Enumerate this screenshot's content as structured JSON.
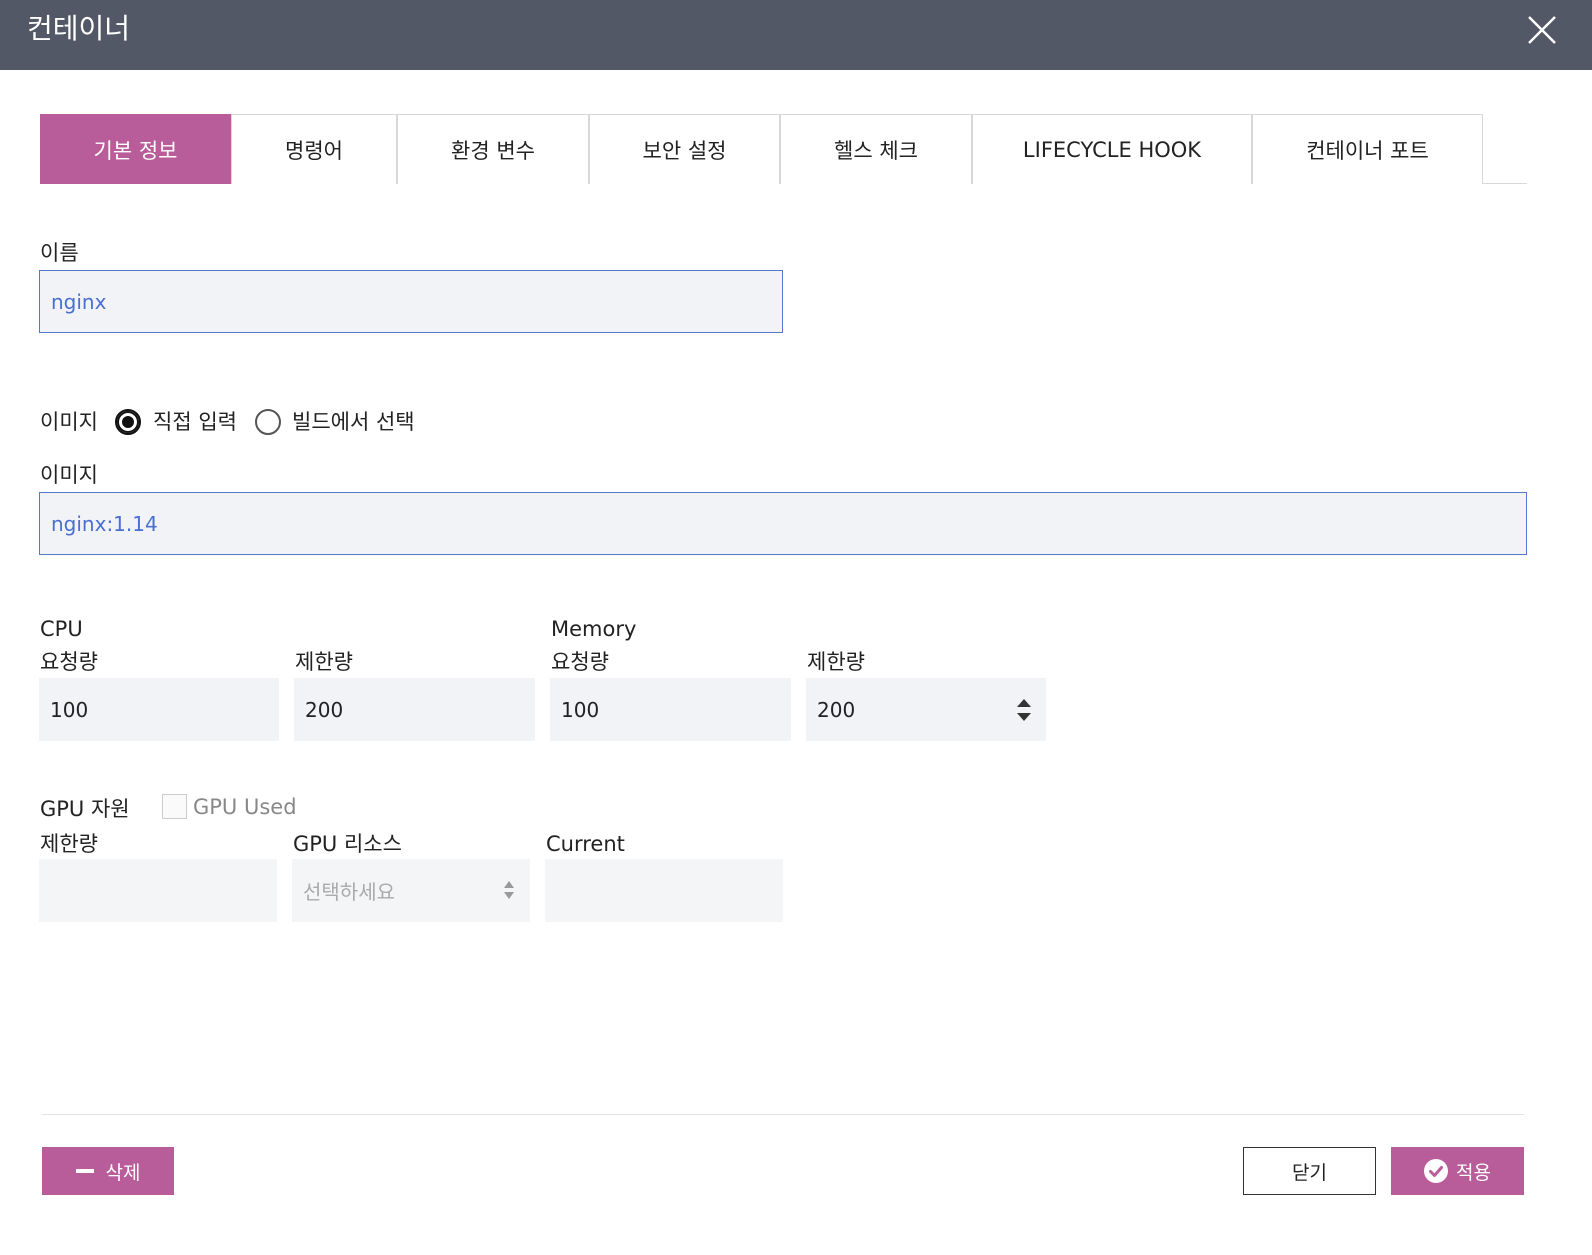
{
  "dialog": {
    "title": "컨테이너"
  },
  "tabs": [
    {
      "label": "기본 정보",
      "active": true
    },
    {
      "label": "명령어",
      "active": false
    },
    {
      "label": "환경 변수",
      "active": false
    },
    {
      "label": "보안 설정",
      "active": false
    },
    {
      "label": "헬스 체크",
      "active": false
    },
    {
      "label": "LIFECYCLE HOOK",
      "active": false
    },
    {
      "label": "컨테이너 포트",
      "active": false
    }
  ],
  "name": {
    "label": "이름",
    "value": "nginx"
  },
  "image_source": {
    "label": "이미지",
    "options": [
      {
        "label": "직접 입력",
        "selected": true
      },
      {
        "label": "빌드에서 선택",
        "selected": false
      }
    ]
  },
  "image": {
    "label": "이미지",
    "value": "nginx:1.14"
  },
  "cpu": {
    "label": "CPU",
    "request_label": "요청량",
    "request_value": "100",
    "limit_label": "제한량",
    "limit_value": "200"
  },
  "memory": {
    "label": "Memory",
    "request_label": "요청량",
    "request_value": "100",
    "limit_label": "제한량",
    "limit_value": "200"
  },
  "gpu": {
    "label": "GPU 자원",
    "used_label": "GPU Used",
    "used_checked": false,
    "limit_label": "제한량",
    "limit_value": "",
    "resource_label": "GPU 리소스",
    "resource_placeholder": "선택하세요",
    "current_label": "Current",
    "current_value": ""
  },
  "footer": {
    "delete_label": "삭제",
    "close_label": "닫기",
    "apply_label": "적용"
  },
  "colors": {
    "header_bg": "#535866",
    "accent": "#b85d99",
    "input_bg": "#f2f3f6",
    "input_border": "#5577cc",
    "input_text": "#4a6fd4"
  },
  "icons": {
    "close": "close-icon",
    "delete": "minus-icon",
    "apply": "check-circle-icon"
  }
}
